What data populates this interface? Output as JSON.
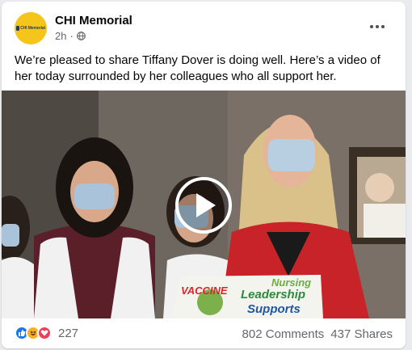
{
  "post": {
    "page_name": "CHI Memorial",
    "avatar_text": "CHI Memorial",
    "time": "2h",
    "separator": "·",
    "privacy_icon": "globe-icon",
    "more_icon": "more-options-icon",
    "text": "We’re pleased to share Tiffany Dover is doing well. Here’s a video of her today surrounded by her colleagues who all support her."
  },
  "video": {
    "play_icon": "play-icon",
    "sign_lines": [
      "VACCINE",
      "Nursing",
      "Leadership",
      "Supports"
    ]
  },
  "footer": {
    "reactions": [
      "like-icon",
      "haha-icon",
      "love-icon"
    ],
    "reaction_count": "227",
    "comments": "802 Comments",
    "shares": "437 Shares"
  },
  "colors": {
    "avatar_bg": "#f5c51c",
    "like": "#1877f2",
    "haha": "#f7b125",
    "love": "#f33e58",
    "meta_text": "#65676b"
  }
}
